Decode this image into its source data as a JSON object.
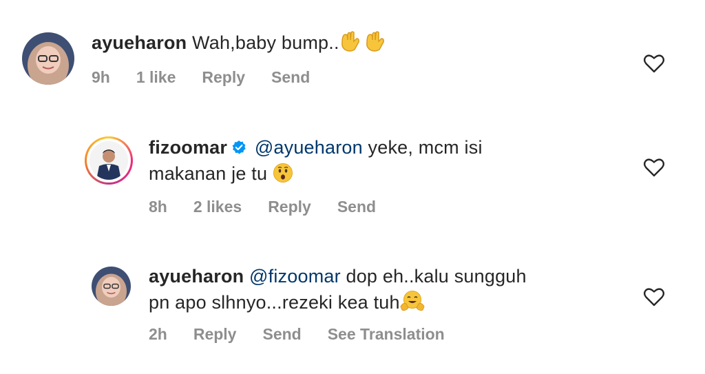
{
  "comments": [
    {
      "username": "ayueharon",
      "text": "Wah,baby bump..",
      "emoji": "open-hands-emoji",
      "time": "9h",
      "likes": "1 like",
      "reply_label": "Reply",
      "send_label": "Send"
    },
    {
      "username": "fizoomar",
      "verified": true,
      "mention": "@ayueharon",
      "text_line1": "yeke, mcm isi",
      "text_line2": "makanan je tu",
      "emoji": "hushed-face-emoji",
      "time": "8h",
      "likes": "2 likes",
      "reply_label": "Reply",
      "send_label": "Send"
    },
    {
      "username": "ayueharon",
      "mention": "@fizoomar",
      "text_line1": "dop eh..kalu sungguh",
      "text_line2": "pn apo slhnyo...rezeki kea tuh",
      "emoji": "hugging-face-emoji",
      "time": "2h",
      "reply_label": "Reply",
      "send_label": "Send",
      "translate_label": "See Translation"
    }
  ],
  "colors": {
    "text": "#262626",
    "meta": "#8e8e8e",
    "mention": "#00376b",
    "verified": "#0095f6"
  }
}
